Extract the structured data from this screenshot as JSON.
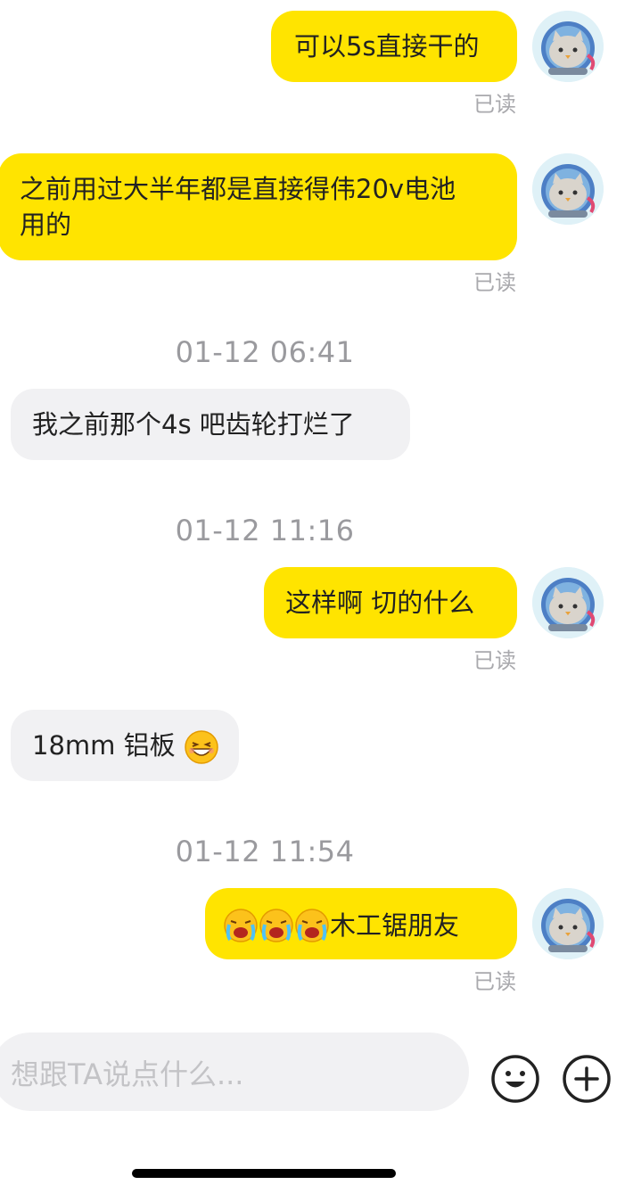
{
  "messages": [
    {
      "type": "out",
      "text": "可以5s直接干的",
      "status": "已读"
    },
    {
      "type": "out",
      "line1": "之前用过大半年都是直接得伟20v电池",
      "line2": "用的",
      "status": "已读"
    },
    {
      "type": "time",
      "text": "01-12 06:41"
    },
    {
      "type": "in",
      "text": "我之前那个4s 吧齿轮打烂了"
    },
    {
      "type": "time",
      "text": "01-12 11:16"
    },
    {
      "type": "out",
      "text": "这样啊 切的什么",
      "status": "已读"
    },
    {
      "type": "in",
      "text": "18mm 铝板",
      "emoji": "grinning-squint-emoji"
    },
    {
      "type": "time",
      "text": "01-12 11:54"
    },
    {
      "type": "out",
      "emoji": "crying-emoji x3",
      "text": "木工锯朋友",
      "status": "已读"
    }
  ],
  "input": {
    "placeholder": "想跟TA说点什么..."
  },
  "icons": {
    "emoji_button": "smiley-icon",
    "add_button": "plus-circle-icon",
    "avatar": "cat-astronaut-avatar"
  },
  "colors": {
    "outgoing_bubble": "#ffe400",
    "incoming_bubble": "#f1f1f3",
    "read_text": "#a9a9ad",
    "timestamp": "#9a9a9e"
  }
}
